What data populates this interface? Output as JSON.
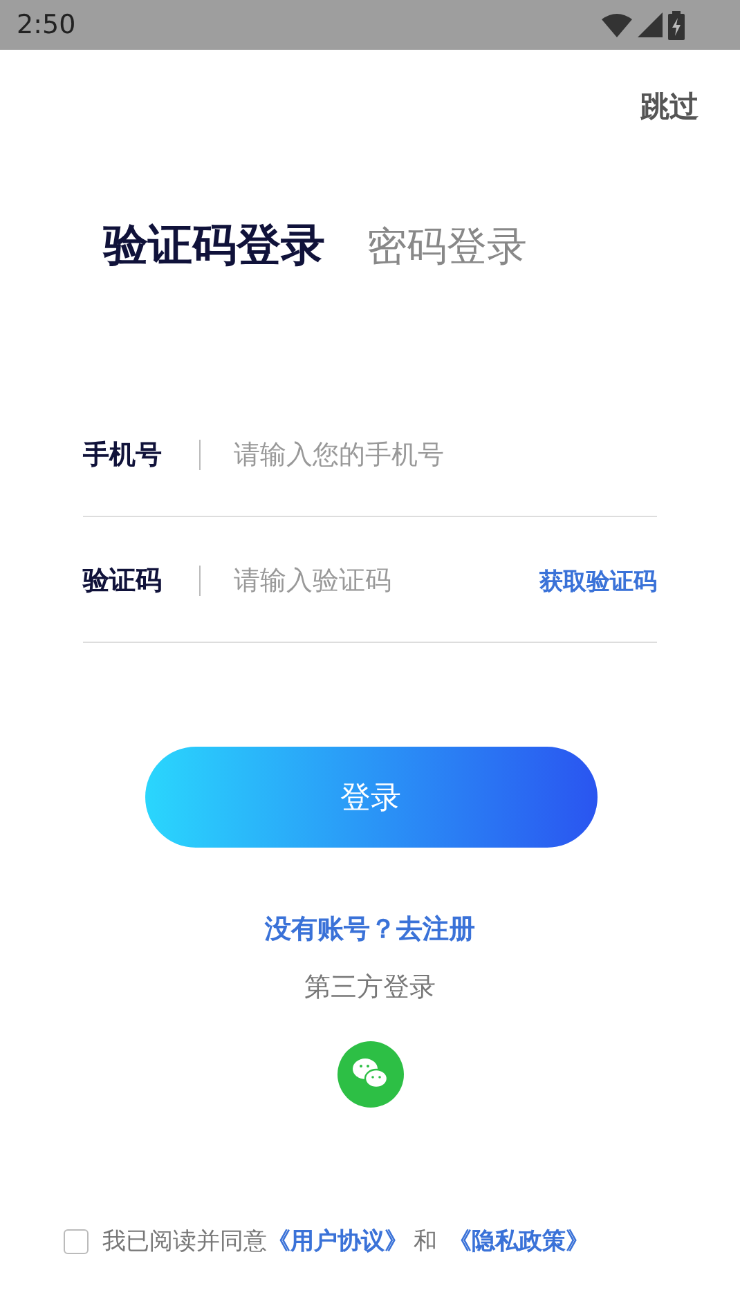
{
  "status_bar": {
    "time": "2:50"
  },
  "skip": "跳过",
  "tabs": [
    {
      "label": "验证码登录",
      "selected": true
    },
    {
      "label": "密码登录",
      "selected": false
    }
  ],
  "fields": [
    {
      "label": "手机号",
      "placeholder": "请输入您的手机号"
    },
    {
      "label": "验证码",
      "placeholder": "请输入验证码",
      "action": "获取验证码"
    }
  ],
  "login_button": "登录",
  "register_link": "没有账号？去注册",
  "third_party": {
    "title": "第三方登录"
  },
  "agreement": {
    "checked": false,
    "text": "我已阅读并同意",
    "link_1": "《用户协议》",
    "joiner": "和",
    "link_2": "《隐私政策》"
  }
}
